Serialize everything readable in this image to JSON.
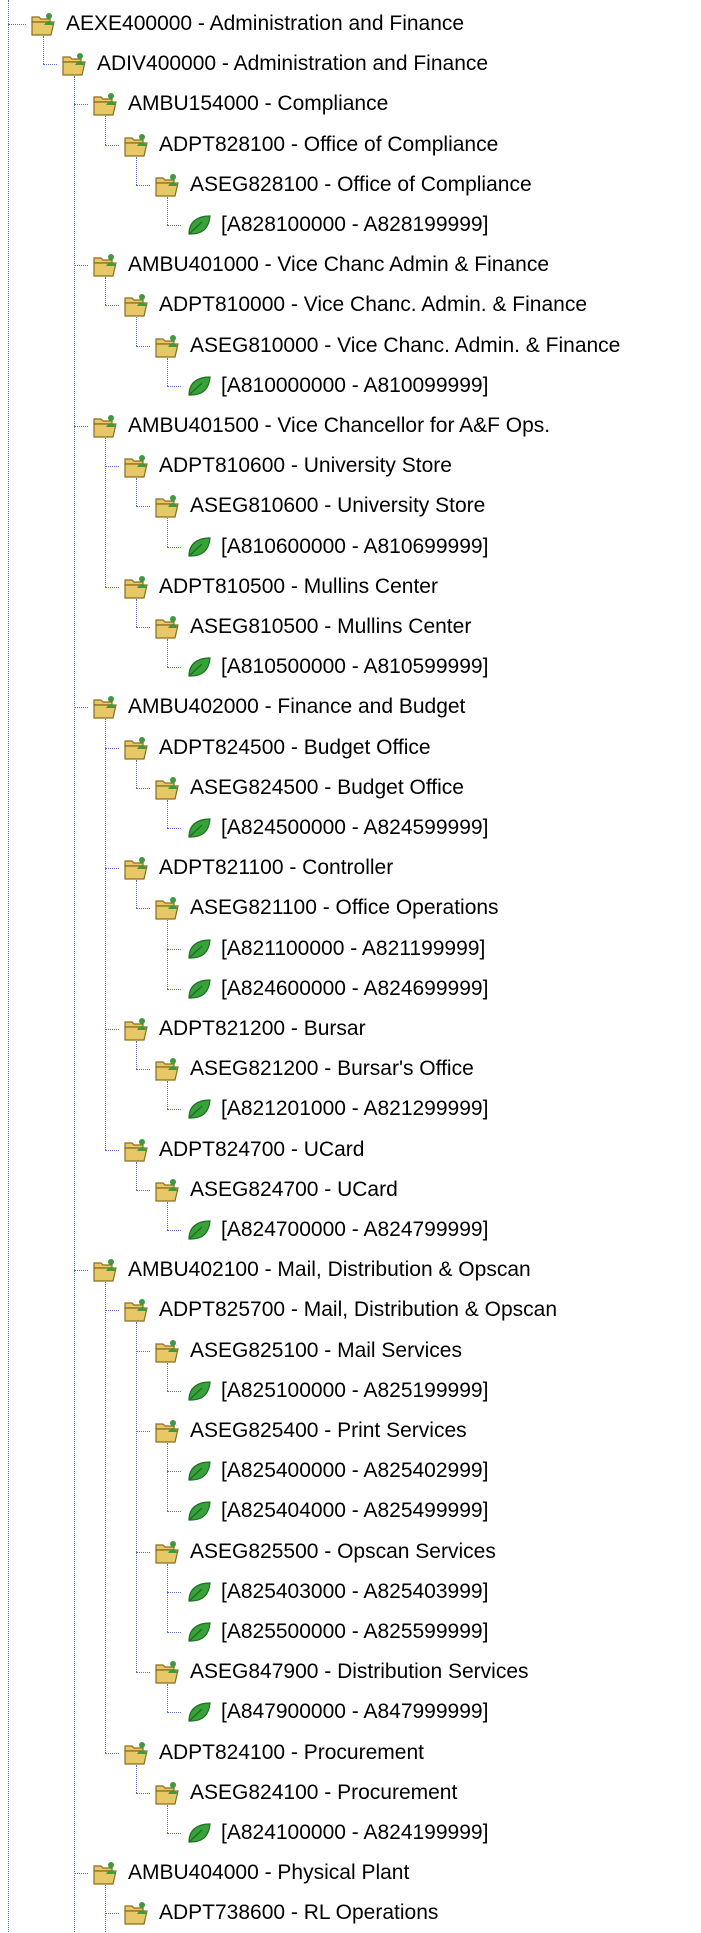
{
  "tree": {
    "nodes": [
      {
        "depth": 0,
        "type": "folder",
        "label": "AEXE400000 - Administration and Finance",
        "last": false
      },
      {
        "depth": 1,
        "type": "folder",
        "label": "ADIV400000 - Administration and Finance",
        "last": true
      },
      {
        "depth": 2,
        "type": "folder",
        "label": "AMBU154000 - Compliance",
        "last": false
      },
      {
        "depth": 3,
        "type": "folder",
        "label": "ADPT828100 - Office of Compliance",
        "last": true
      },
      {
        "depth": 4,
        "type": "folder",
        "label": "ASEG828100 - Office of Compliance",
        "last": true
      },
      {
        "depth": 5,
        "type": "leaf",
        "label": "[A828100000 - A828199999]",
        "last": true
      },
      {
        "depth": 2,
        "type": "folder",
        "label": "AMBU401000 - Vice Chanc Admin & Finance",
        "last": false
      },
      {
        "depth": 3,
        "type": "folder",
        "label": "ADPT810000 - Vice Chanc. Admin. & Finance",
        "last": true
      },
      {
        "depth": 4,
        "type": "folder",
        "label": "ASEG810000 - Vice Chanc. Admin. & Finance",
        "last": true
      },
      {
        "depth": 5,
        "type": "leaf",
        "label": "[A810000000 - A810099999]",
        "last": true
      },
      {
        "depth": 2,
        "type": "folder",
        "label": "AMBU401500 - Vice Chancellor for A&F Ops.",
        "last": false
      },
      {
        "depth": 3,
        "type": "folder",
        "label": "ADPT810600 - University Store",
        "last": false
      },
      {
        "depth": 4,
        "type": "folder",
        "label": "ASEG810600 - University Store",
        "last": true
      },
      {
        "depth": 5,
        "type": "leaf",
        "label": "[A810600000 - A810699999]",
        "last": true
      },
      {
        "depth": 3,
        "type": "folder",
        "label": "ADPT810500 - Mullins Center",
        "last": true
      },
      {
        "depth": 4,
        "type": "folder",
        "label": "ASEG810500 - Mullins Center",
        "last": true
      },
      {
        "depth": 5,
        "type": "leaf",
        "label": "[A810500000 - A810599999]",
        "last": true
      },
      {
        "depth": 2,
        "type": "folder",
        "label": "AMBU402000 - Finance and Budget",
        "last": false
      },
      {
        "depth": 3,
        "type": "folder",
        "label": "ADPT824500 - Budget Office",
        "last": false
      },
      {
        "depth": 4,
        "type": "folder",
        "label": "ASEG824500 - Budget Office",
        "last": true
      },
      {
        "depth": 5,
        "type": "leaf",
        "label": "[A824500000 - A824599999]",
        "last": true
      },
      {
        "depth": 3,
        "type": "folder",
        "label": "ADPT821100 - Controller",
        "last": false
      },
      {
        "depth": 4,
        "type": "folder",
        "label": "ASEG821100 - Office Operations",
        "last": true
      },
      {
        "depth": 5,
        "type": "leaf",
        "label": "[A821100000 - A821199999]",
        "last": false
      },
      {
        "depth": 5,
        "type": "leaf",
        "label": "[A824600000 - A824699999]",
        "last": true
      },
      {
        "depth": 3,
        "type": "folder",
        "label": "ADPT821200 - Bursar",
        "last": false
      },
      {
        "depth": 4,
        "type": "folder",
        "label": "ASEG821200 - Bursar's Office",
        "last": true
      },
      {
        "depth": 5,
        "type": "leaf",
        "label": "[A821201000 - A821299999]",
        "last": true
      },
      {
        "depth": 3,
        "type": "folder",
        "label": "ADPT824700 - UCard",
        "last": true
      },
      {
        "depth": 4,
        "type": "folder",
        "label": "ASEG824700 - UCard",
        "last": true
      },
      {
        "depth": 5,
        "type": "leaf",
        "label": "[A824700000 - A824799999]",
        "last": true
      },
      {
        "depth": 2,
        "type": "folder",
        "label": "AMBU402100 - Mail, Distribution & Opscan",
        "last": false
      },
      {
        "depth": 3,
        "type": "folder",
        "label": "ADPT825700 - Mail, Distribution & Opscan",
        "last": false
      },
      {
        "depth": 4,
        "type": "folder",
        "label": "ASEG825100 - Mail Services",
        "last": false
      },
      {
        "depth": 5,
        "type": "leaf",
        "label": "[A825100000 - A825199999]",
        "last": true
      },
      {
        "depth": 4,
        "type": "folder",
        "label": "ASEG825400 - Print Services",
        "last": false
      },
      {
        "depth": 5,
        "type": "leaf",
        "label": "[A825400000 - A825402999]",
        "last": false
      },
      {
        "depth": 5,
        "type": "leaf",
        "label": "[A825404000 - A825499999]",
        "last": true
      },
      {
        "depth": 4,
        "type": "folder",
        "label": "ASEG825500 - Opscan Services",
        "last": false
      },
      {
        "depth": 5,
        "type": "leaf",
        "label": "[A825403000 - A825403999]",
        "last": false
      },
      {
        "depth": 5,
        "type": "leaf",
        "label": "[A825500000 - A825599999]",
        "last": true
      },
      {
        "depth": 4,
        "type": "folder",
        "label": "ASEG847900 - Distribution Services",
        "last": true
      },
      {
        "depth": 5,
        "type": "leaf",
        "label": "[A847900000 - A847999999]",
        "last": true
      },
      {
        "depth": 3,
        "type": "folder",
        "label": "ADPT824100 - Procurement",
        "last": true
      },
      {
        "depth": 4,
        "type": "folder",
        "label": "ASEG824100 - Procurement",
        "last": true
      },
      {
        "depth": 5,
        "type": "leaf",
        "label": "[A824100000 - A824199999]",
        "last": true
      },
      {
        "depth": 2,
        "type": "folder",
        "label": "AMBU404000 - Physical Plant",
        "last": false
      },
      {
        "depth": 3,
        "type": "folder",
        "label": "ADPT738600 - RL Operations",
        "last": false
      }
    ]
  },
  "colors": {
    "connector": "#5a6fbf",
    "folder": "#e8c766",
    "folder_edge": "#8a6d1e",
    "person": "#3f9a3f",
    "leaf": "#37a23a"
  },
  "icons": {
    "folder": "open-folder-person-icon",
    "leaf": "leaf-icon"
  }
}
